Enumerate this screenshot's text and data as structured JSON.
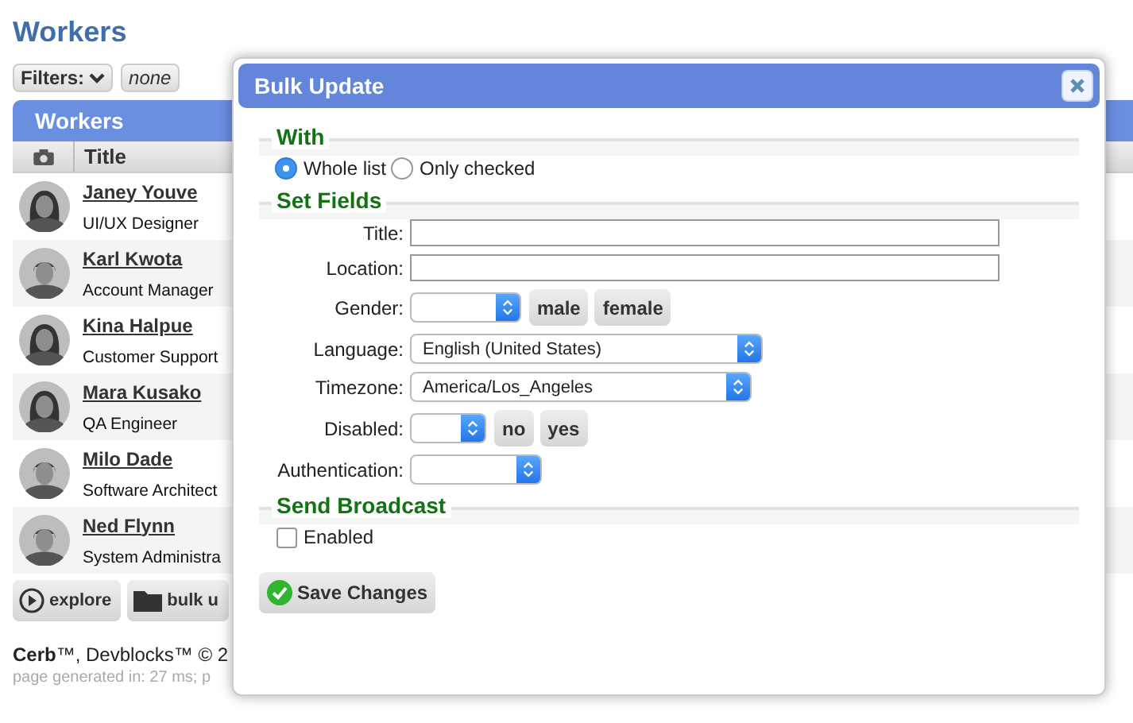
{
  "page": {
    "title": "Workers",
    "filters": {
      "label": "Filters:",
      "value": "none"
    }
  },
  "worklist": {
    "title": "Workers",
    "columns": [
      "Title"
    ],
    "rows": [
      {
        "name": "Janey Youve",
        "title": "UI/UX Designer"
      },
      {
        "name": "Karl Kwota",
        "title": "Account Manager"
      },
      {
        "name": "Kina Halpue",
        "title": "Customer Support"
      },
      {
        "name": "Mara Kusako",
        "title": "QA Engineer"
      },
      {
        "name": "Milo Dade",
        "title": "Software Architect"
      },
      {
        "name": "Ned Flynn",
        "title": "System Administra"
      }
    ],
    "buttons": [
      {
        "label": "explore"
      },
      {
        "label": "bulk u"
      }
    ]
  },
  "footer": {
    "credits": "**Cerb**™, Devblocks™ © 2",
    "timing": "page generated in: 27 ms; p"
  },
  "dialog": {
    "title": "Bulk Update",
    "with": {
      "legend": "With",
      "options": [
        {
          "label": "Whole list",
          "selected": true
        },
        {
          "label": "Only checked",
          "selected": false
        }
      ]
    },
    "set_fields": {
      "legend": "Set Fields",
      "fields": [
        {
          "label": "Title:",
          "kind": "text"
        },
        {
          "label": "Location:",
          "kind": "text"
        },
        {
          "label": "Gender:",
          "kind": "select",
          "buttons": [
            "male",
            "female"
          ]
        },
        {
          "label": "Language:",
          "kind": "select",
          "value": "English (United States)"
        },
        {
          "label": "Timezone:",
          "kind": "select",
          "value": "America/Los_Angeles"
        },
        {
          "label": "Disabled:",
          "kind": "select",
          "buttons": [
            "no",
            "yes"
          ]
        },
        {
          "label": "Authentication:",
          "kind": "select"
        }
      ]
    },
    "broadcast": {
      "legend": "Send Broadcast",
      "option": {
        "label": "Enabled",
        "checked": false
      }
    },
    "save": "Save Changes"
  }
}
